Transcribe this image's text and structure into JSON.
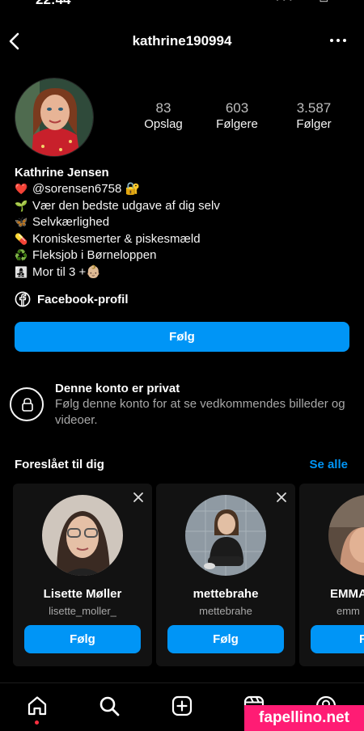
{
  "status_bar": {
    "time": "22:44",
    "icons": "••• ◠ ▭"
  },
  "header": {
    "username": "kathrine190994"
  },
  "stats": [
    {
      "num": "83",
      "label": "Opslag"
    },
    {
      "num": "603",
      "label": "Følgere"
    },
    {
      "num": "3.587",
      "label": "Følger"
    }
  ],
  "bio": {
    "name": "Kathrine Jensen",
    "lines": [
      {
        "emoji": "❤️",
        "text": "@sorensen6758 🔐"
      },
      {
        "emoji": "🌱",
        "text": "Vær den bedste udgave af dig selv"
      },
      {
        "emoji": "🦋",
        "text": "Selvkærlighed"
      },
      {
        "emoji": "💊",
        "text": "Kroniskesmerter & piskesmæld"
      },
      {
        "emoji": "♻️",
        "text": "Fleksjob i Børneloppen"
      },
      {
        "emoji": "👩‍👧‍👦",
        "text": "Mor til 3 +👶🏼"
      }
    ],
    "facebook_link": "Facebook-profil"
  },
  "follow_button": "Følg",
  "private_account": {
    "title": "Denne konto er privat",
    "description": "Følg denne konto for at se vedkommendes billeder og videoer."
  },
  "suggestions": {
    "title": "Foreslået til dig",
    "see_all": "Se alle",
    "cards": [
      {
        "name": "Lisette Møller",
        "username": "lisette_moller_",
        "button": "Følg"
      },
      {
        "name": "mettebrahe",
        "username": "mettebrahe",
        "button": "Følg"
      },
      {
        "name": "EMMA",
        "username": "emm",
        "button": "Fø"
      }
    ]
  },
  "watermark": "fapellino.net",
  "colors": {
    "accent": "#0095f6",
    "background": "#000000",
    "card": "#121212",
    "muted": "#a8a8a8"
  },
  "icons": {
    "nav": [
      "home-icon",
      "search-icon",
      "create-icon",
      "reels-icon",
      "profile-icon"
    ]
  }
}
